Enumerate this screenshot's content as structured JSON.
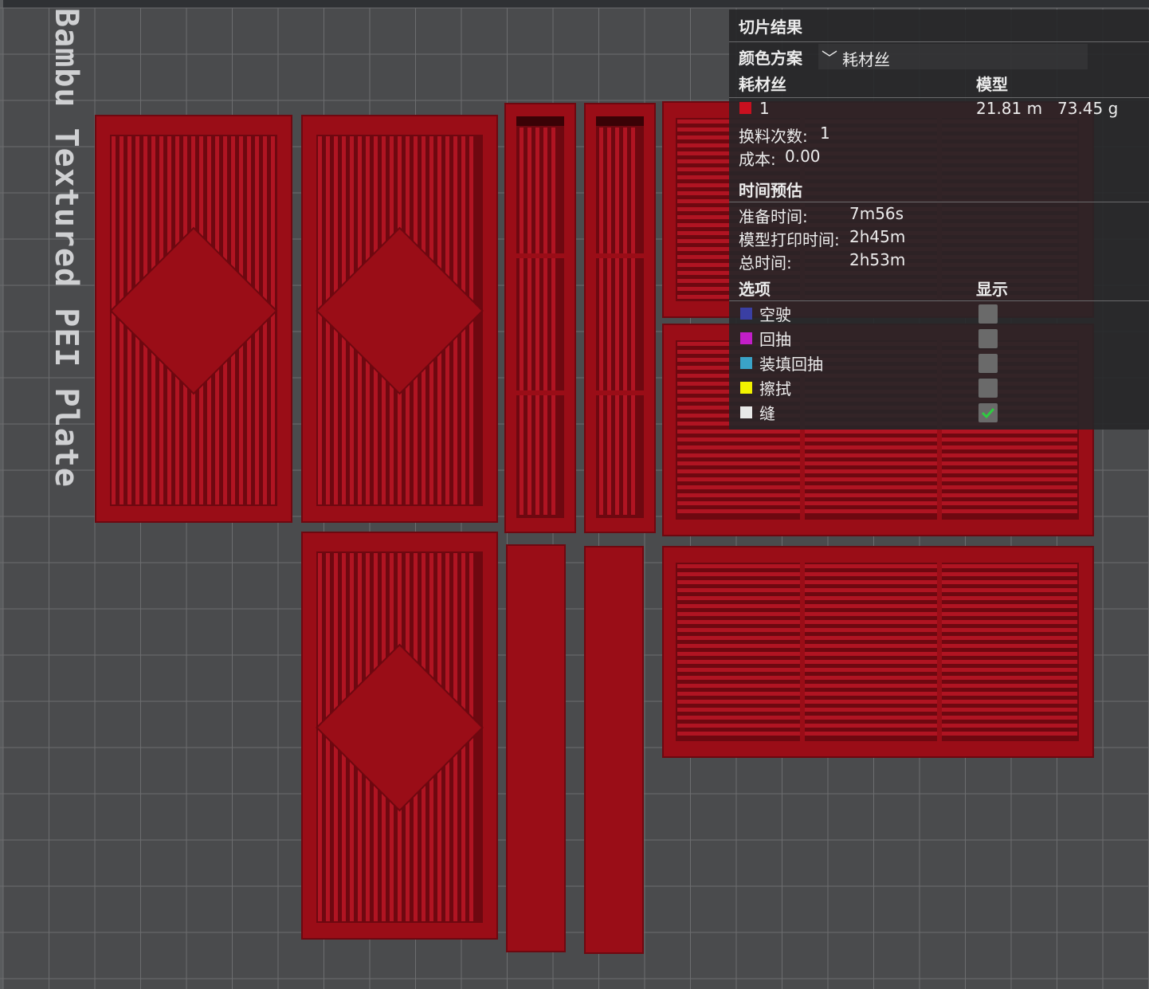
{
  "viewport": {
    "plate_label": "Bambu Textured PEI Plate",
    "bed_color": "#4a4b4d",
    "grid_color": "#6c6d6f",
    "part_color": "#9a0d17"
  },
  "panel": {
    "title": "切片结果",
    "color_scheme_label": "颜色方案",
    "color_scheme_value": "耗材丝",
    "filament_header": "耗材丝",
    "model_header": "模型",
    "filament": {
      "id": "1",
      "color": "#c8101f",
      "length": "21.81 m",
      "weight": "73.45 g"
    },
    "swaps_label": "换料次数:",
    "swaps_value": "1",
    "cost_label": "成本:",
    "cost_value": "0.00",
    "time_header": "时间预估",
    "prepare_label": "准备时间:",
    "prepare_value": "7m56s",
    "print_label": "模型打印时间:",
    "print_value": "2h45m",
    "total_label": "总时间:",
    "total_value": "2h53m",
    "options_header": "选项",
    "display_header": "显示",
    "options": [
      {
        "label": "空驶",
        "color": "#3a3fa3",
        "checked": false
      },
      {
        "label": "回抽",
        "color": "#c21ec8",
        "checked": false
      },
      {
        "label": "装填回抽",
        "color": "#3aa3c8",
        "checked": false
      },
      {
        "label": "擦拭",
        "color": "#f2f200",
        "checked": false
      },
      {
        "label": "缝",
        "color": "#e8e8e8",
        "checked": true
      }
    ]
  }
}
